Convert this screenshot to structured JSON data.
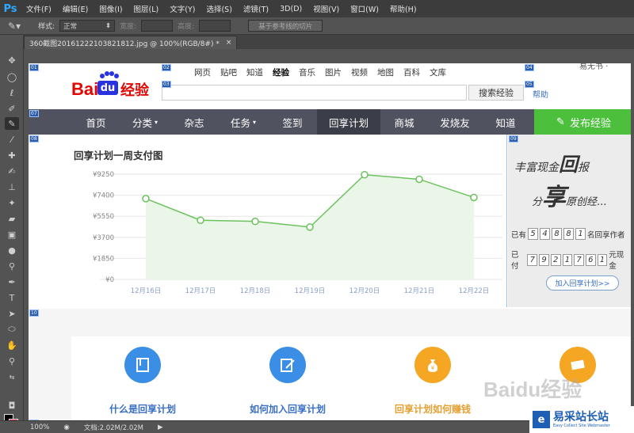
{
  "app": {
    "logo": "Ps"
  },
  "menu": [
    "文件(F)",
    "编辑(E)",
    "图像(I)",
    "图层(L)",
    "文字(Y)",
    "选择(S)",
    "滤镜(T)",
    "3D(D)",
    "视图(V)",
    "窗口(W)",
    "帮助(H)"
  ],
  "options": {
    "style_label": "样式:",
    "style_value": "正常",
    "width_label": "宽度:",
    "height_label": "高度:",
    "slice_button": "基于参考线的切片"
  },
  "document_tab": {
    "title": "360截图20161222103821812.jpg @ 100%(RGB/8#) *",
    "close": "×"
  },
  "slices": [
    "01",
    "02",
    "03",
    "04",
    "05",
    "06",
    "07",
    "08",
    "09",
    "10",
    "11"
  ],
  "header": {
    "logo_bai": "Bai",
    "logo_du": "du",
    "logo_jingyan": "经验",
    "topnav": [
      "网页",
      "贴吧",
      "知道",
      "经验",
      "音乐",
      "图片",
      "视频",
      "地图",
      "百科",
      "文库"
    ],
    "search_button": "搜索经验",
    "help": "帮助",
    "user": "易无书 · "
  },
  "navbar": {
    "items": [
      "首页",
      "分类",
      "杂志",
      "任务",
      "签到",
      "回享计划",
      "商城",
      "发烧友",
      "知道"
    ],
    "publish": "发布经验"
  },
  "chart_data": {
    "type": "area",
    "title": "回享计划一周支付图",
    "categories": [
      "12月16日",
      "12月17日",
      "12月18日",
      "12月19日",
      "12月20日",
      "12月21日",
      "12月22日"
    ],
    "values": [
      7100,
      5200,
      5100,
      4600,
      9200,
      8800,
      7200
    ],
    "yticks": [
      "¥9250",
      "¥7400",
      "¥5550",
      "¥3700",
      "¥1850",
      "¥0"
    ],
    "ytick_values": [
      9250,
      7400,
      5550,
      3700,
      1850,
      0
    ],
    "ylim": [
      0,
      9250
    ],
    "grid": true,
    "line_color": "#6cc25d",
    "fill_color": "#eaf6e8"
  },
  "right_ad": {
    "slogan_line1": "丰富现金",
    "slogan_big1": "回",
    "slogan_line1_end": "报",
    "slogan_line2": "分",
    "slogan_big2": "享",
    "slogan_line2_end": "原创经...",
    "row1_prefix": "已有",
    "row1_digits": [
      "5",
      "4",
      "8",
      "8",
      "1"
    ],
    "row1_suffix": "名回享作者",
    "row2_prefix": "已付",
    "row2_digits": [
      "7",
      "9",
      "2",
      "1",
      "7",
      "6",
      "1"
    ],
    "row2_suffix": "元现金",
    "join_button": "加入回享计划>>"
  },
  "features": [
    {
      "label": "什么是回享计划",
      "color": "#3a8ee6",
      "label_color": "#3a6fc4"
    },
    {
      "label": "如何加入回享计划",
      "color": "#3a8ee6",
      "label_color": "#3a6fc4"
    },
    {
      "label": "回享计划如何赚钱",
      "color": "#f5a623",
      "label_color": "#e5a033"
    },
    {
      "label": "",
      "color": "#f5a623",
      "label_color": "#e5a033"
    }
  ],
  "status": {
    "zoom": "100%",
    "doc": "文档:2.02M/2.02M"
  },
  "watermark": {
    "baidu": "Baidu经验",
    "site_icon": "e",
    "site_name": "易采站长站",
    "site_sub": "Easy Collect Site Webmaster"
  }
}
